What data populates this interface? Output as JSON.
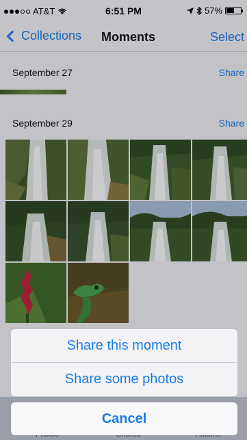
{
  "status_bar": {
    "carrier": "AT&T",
    "time": "6:51 PM",
    "battery": "57%",
    "battery_level": 0.57
  },
  "nav": {
    "back_label": "Collections",
    "title": "Moments",
    "action_label": "Select"
  },
  "sections": [
    {
      "date": "September 27",
      "share_label": "Share"
    },
    {
      "date": "September 29",
      "share_label": "Share"
    }
  ],
  "photos": [
    "waterfall",
    "waterfall",
    "waterfall",
    "waterfall",
    "waterfall",
    "waterfall",
    "waterfall",
    "waterfall",
    "red-flower",
    "green-lizard"
  ],
  "tab_bar": {
    "tabs": [
      "Photos",
      "Shared",
      "Albums"
    ]
  },
  "action_sheet": {
    "options": [
      "Share this moment",
      "Share some photos"
    ],
    "cancel_label": "Cancel"
  },
  "colors": {
    "accent": "#1a7ce6"
  }
}
